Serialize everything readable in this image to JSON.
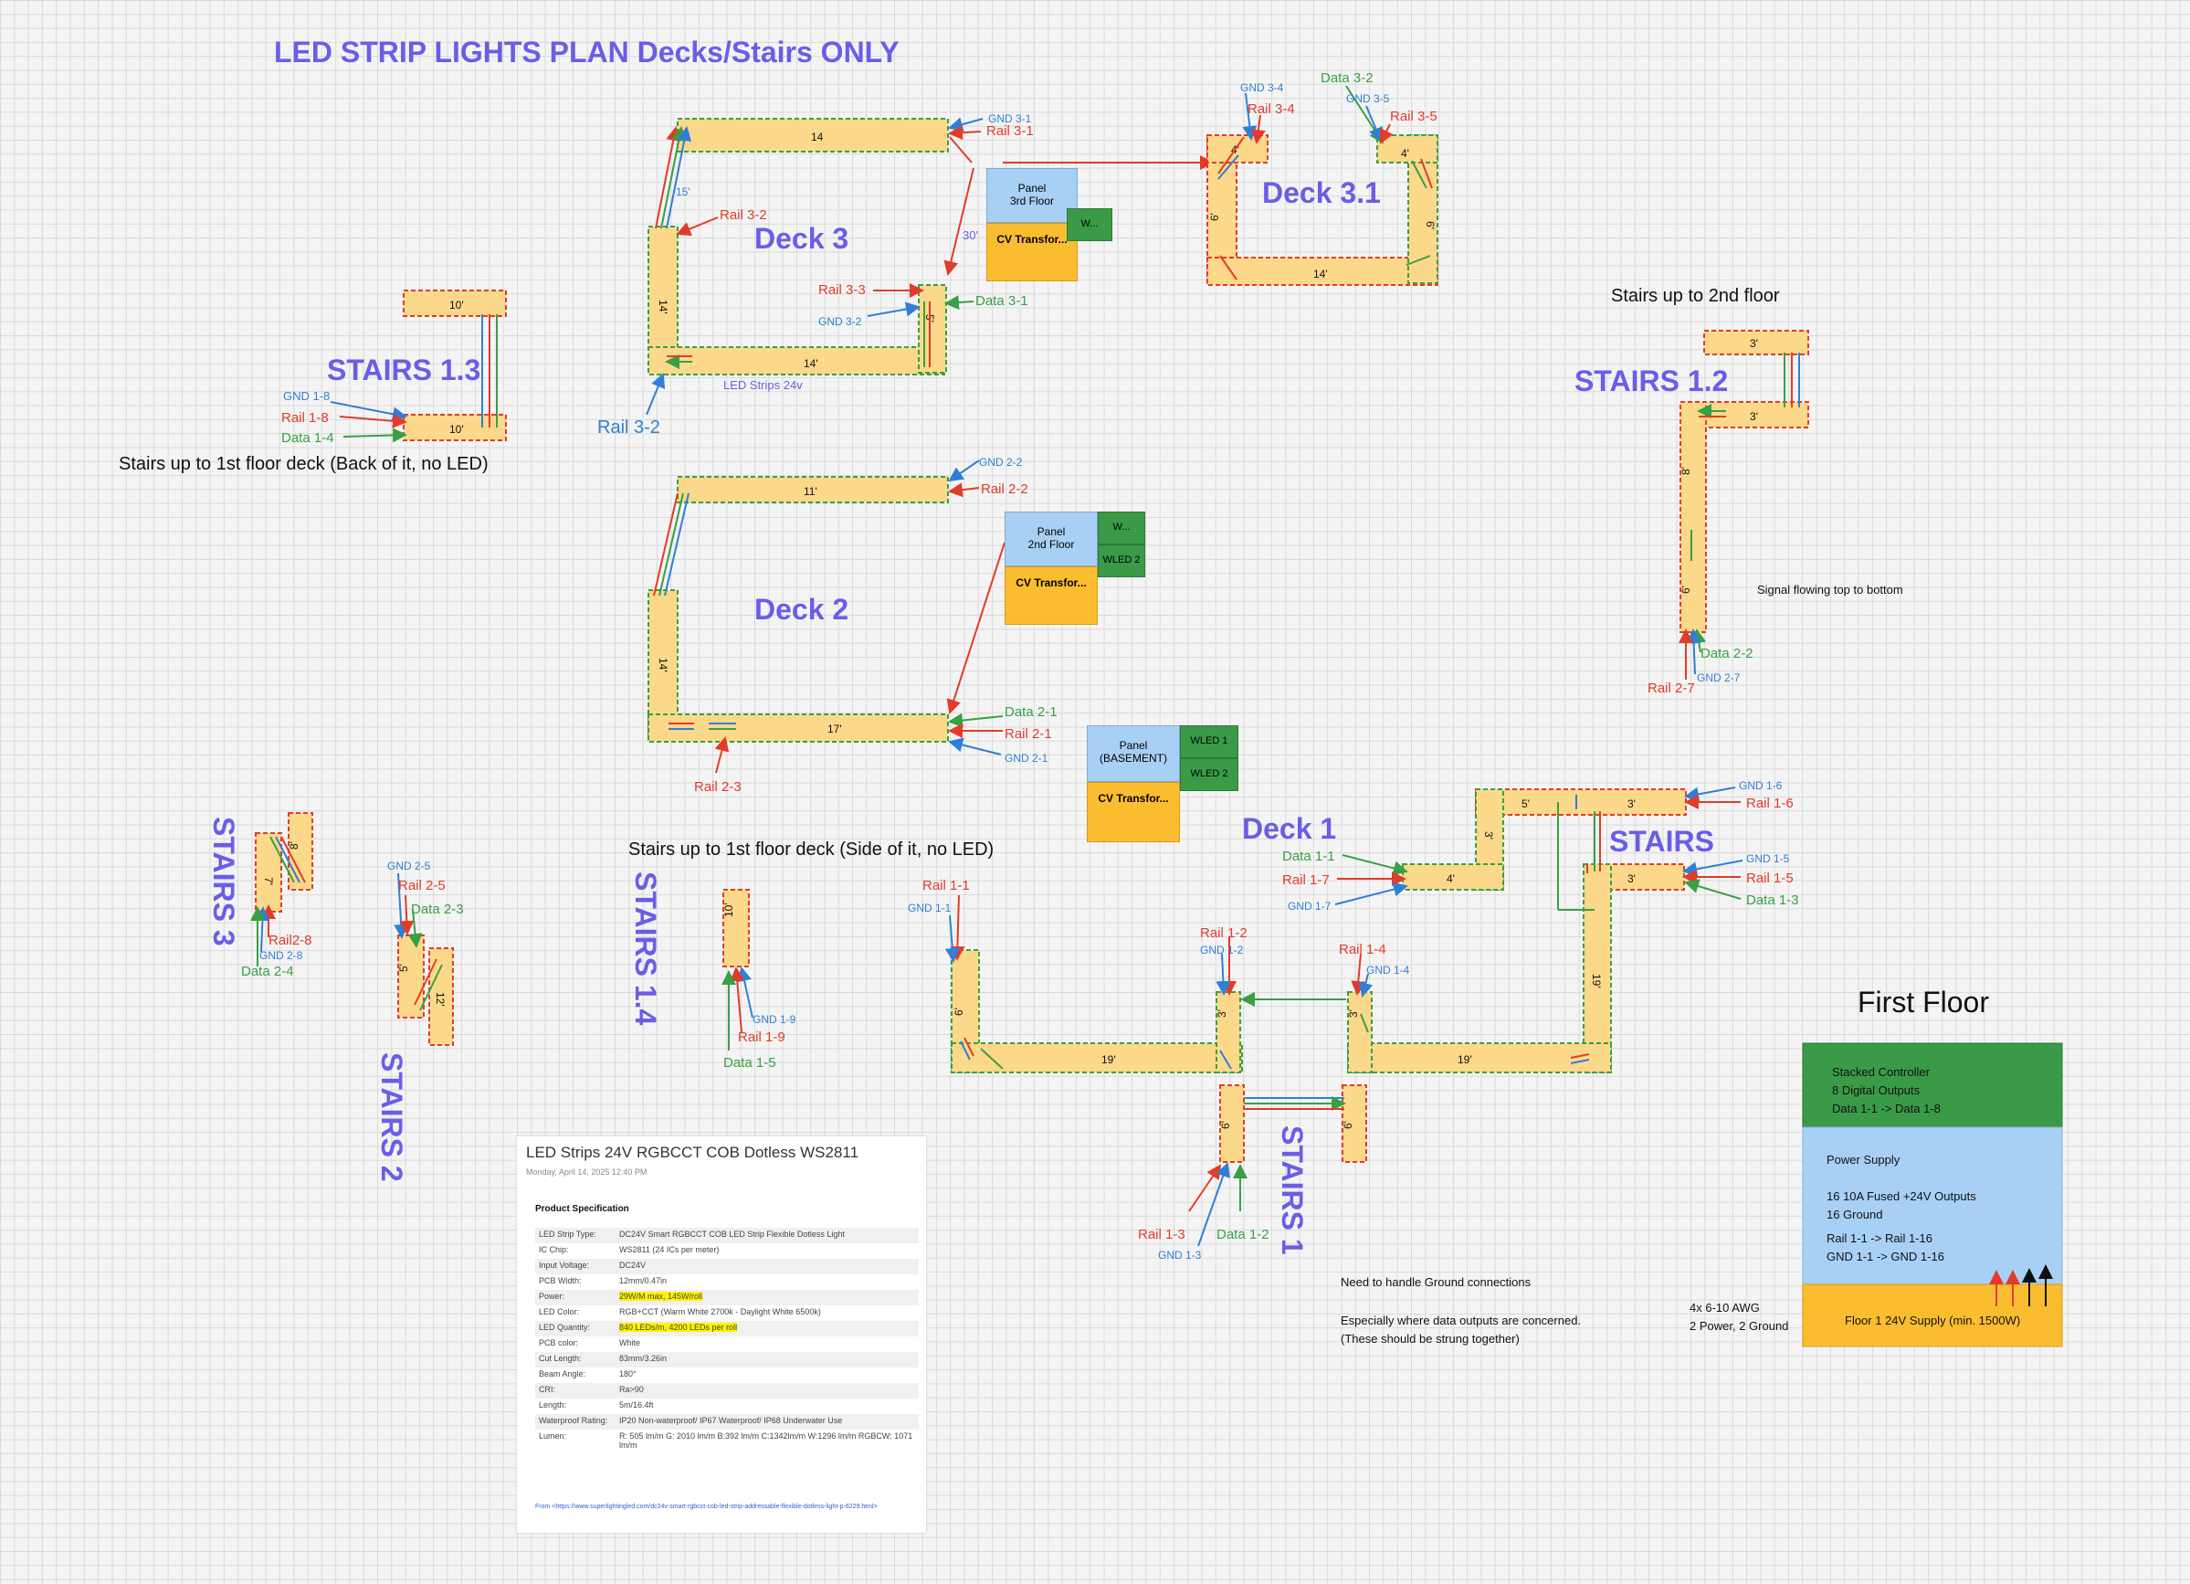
{
  "title": "LED STRIP LIGHTS PLAN Decks/Stairs ONLY",
  "areas": {
    "deck3": "Deck 3",
    "deck31": "Deck 3.1",
    "deck2": "Deck 2",
    "deck1": "Deck 1",
    "stairs13": "STAIRS 1.3",
    "stairs12": "STAIRS 1.2",
    "stairs3": "STAIRS 3",
    "stairs2": "STAIRS 2",
    "stairs14": "STAIRS 1.4",
    "stairs1": "STAIRS 1",
    "stairs": "STAIRS",
    "first_floor": "First Floor"
  },
  "notes": {
    "stairs_2nd": "Stairs up to 2nd floor",
    "stairs_back": "Stairs up to 1st floor deck (Back of it, no LED)",
    "stairs_side": "Stairs up to 1st floor deck (Side of it, no LED)",
    "signal": "Signal flowing top to bottom",
    "ground1": "Need to handle Ground connections",
    "ground2": "Especially where data outputs are concerned.",
    "ground3": "(These should be strung together)",
    "awg1": "4x 6-10 AWG",
    "awg2": "2 Power, 2 Ground",
    "led24": "LED Strips 24v"
  },
  "strip_labels": {
    "d3_top": "14",
    "d3_left": "14'",
    "d3_bottom": "14'",
    "d3_right": "5'",
    "d3_diag": "15'",
    "d3_30": "30'",
    "d31_left": "6'",
    "d31_bottom": "14'",
    "d31_right": "6'",
    "d31_tl": "4'",
    "d31_tr": "4'",
    "s13_top": "10'",
    "s13_bottom": "10'",
    "s12_top": "3'",
    "s12_mid": "3'",
    "s12_a": "8'",
    "s12_b": "6'",
    "d2_top": "11'",
    "d2_left": "14'",
    "d2_bottom": "17'",
    "s3_a": "7'",
    "s3_b": "8'",
    "s2_a": "5'",
    "s2_b": "12'",
    "s14": "10'",
    "d1_a": "5'",
    "d1_b": "3'",
    "d1_c": "3'",
    "d1_d": "3'",
    "d1_e": "4'",
    "d1_f": "19'",
    "d1_left": "6'",
    "d1_bottom_l": "19'",
    "d1_bottom_r": "19'",
    "d1_m1": "3'",
    "d1_m2": "3'",
    "s1_a": "6'",
    "s1_b": "6'"
  },
  "wires": {
    "gnd31": "GND 3-1",
    "rail31": "Rail 3-1",
    "rail32": "Rail 3-2",
    "rail32b": "Rail 3-2",
    "rail33": "Rail 3-3",
    "gnd32": "GND 3-2",
    "data31": "Data 3-1",
    "gnd34": "GND 3-4",
    "rail34": "Rail 3-4",
    "data32": "Data 3-2",
    "gnd35": "GND 3-5",
    "rail35": "Rail 3-5",
    "gnd18": "GND 1-8",
    "rail18": "Rail 1-8",
    "data14": "Data 1-4",
    "gnd22": "GND 2-2",
    "rail22": "Rail 2-2",
    "data21": "Data 2-1",
    "rail21": "Rail 2-1",
    "gnd21": "GND 2-1",
    "rail23": "Rail 2-3",
    "data22": "Data 2-2",
    "gnd27": "GND 2-7",
    "rail27": "Rail 2-7",
    "gnd25": "GND 2-5",
    "rail25": "Rail 2-5",
    "data23": "Data 2-3",
    "rail28": "Rail2-8",
    "gnd28": "GND 2-8",
    "data24": "Data 2-4",
    "gnd19": "GND 1-9",
    "rail19": "Rail 1-9",
    "data15": "Data 1-5",
    "rail11": "Rail 1-1",
    "gnd11": "GND 1-1",
    "rail12": "Rail 1-2",
    "gnd12": "GND 1-2",
    "rail14": "Rail 1-4",
    "gnd14": "GND 1-4",
    "data11": "Data 1-1",
    "rail17": "Rail 1-7",
    "gnd17": "GND 1-7",
    "gnd16": "GND 1-6",
    "rail16": "Rail 1-6",
    "gnd15": "GND 1-5",
    "rail15": "Rail 1-5",
    "data13": "Data 1-3",
    "rail13": "Rail 1-3",
    "gnd13": "GND 1-3",
    "data12": "Data 1-2"
  },
  "panels": {
    "p3_name": "Panel",
    "p3_floor": "3rd Floor",
    "p3_cv": "CV Transfor...",
    "p3_w": "W...",
    "p2_name": "Panel",
    "p2_floor": "2nd Floor",
    "p2_cv": "CV Transfor...",
    "p2_w": "W...",
    "p2_wled": "WLED 2",
    "pb_name": "Panel",
    "pb_floor": "(BASEMENT)",
    "pb_cv": "CV Transfor...",
    "pb_wled1": "WLED 1",
    "pb_wled2": "WLED 2"
  },
  "first_floor_box": {
    "ctrl1": "Stacked Controller",
    "ctrl2": "8 Digital Outputs",
    "ctrl3": "Data 1-1 -> Data 1-8",
    "ps1": "Power Supply",
    "ps2": "16 10A Fused +24V Outputs",
    "ps3": "16 Ground",
    "ps4": "Rail 1-1 -> Rail 1-16",
    "ps5": "GND 1-1 -> GND 1-16",
    "supply": "Floor 1 24V Supply (min. 1500W)"
  },
  "spec": {
    "title": "LED Strips 24V RGBCCT COB Dotless WS2811",
    "date": "Monday, April 14, 2025        12:40 PM",
    "heading": "Product Specification",
    "rows": [
      {
        "k": "LED Strip Type:",
        "v": "DC24V Smart RGBCCT COB LED Strip Flexible Dotless Light"
      },
      {
        "k": "IC Chip:",
        "v": "WS2811 (24 ICs per meter)"
      },
      {
        "k": "Input Voltage:",
        "v": "DC24V"
      },
      {
        "k": "PCB Width:",
        "v": "12mm/0.47in"
      },
      {
        "k": "Power:",
        "v": "29W/M max, 145W/roll"
      },
      {
        "k": "LED Color:",
        "v": "RGB+CCT (Warm White 2700k - Daylight White 6500k)"
      },
      {
        "k": "LED Quantity:",
        "v": "840 LEDs/m, 4200 LEDs per roll"
      },
      {
        "k": "PCB color:",
        "v": "White"
      },
      {
        "k": "Cut Length:",
        "v": "83mm/3.26in"
      },
      {
        "k": "Beam Angle:",
        "v": "180°"
      },
      {
        "k": "CRI:",
        "v": "Ra>90"
      },
      {
        "k": "Length:",
        "v": "5m/16.4ft"
      },
      {
        "k": "Waterproof Rating:",
        "v": "IP20 Non-waterproof/ IP67 Waterproof/ IP68 Underwater Use"
      },
      {
        "k": "Lumen:",
        "v": "R: 505 lm/m  G: 2010 lm/m  B:392 lm/m  C:1342lm/m  W:1296 lm/m  RGBCW: 1071 lm/m"
      }
    ],
    "from": "From <https://www.superlightingled.com/dc24v-smart-rgbcct-cob-led-strip-addressable-flexible-dotless-light-p-6229.html>"
  },
  "colors": {
    "rail": "#e23b2a",
    "gnd": "#2f7fd6",
    "data": "#38a043",
    "strip": "#fcd88a",
    "title": "#6b5de6"
  }
}
